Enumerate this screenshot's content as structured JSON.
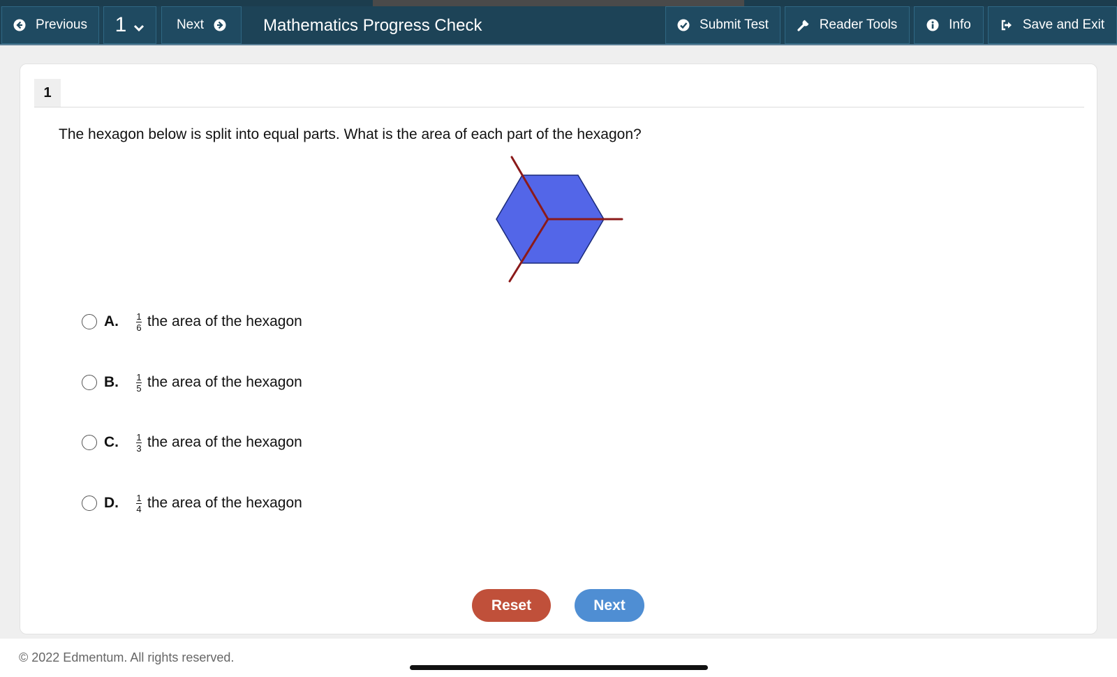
{
  "toolbar": {
    "previous_label": "Previous",
    "question_number": "1",
    "next_label": "Next",
    "title": "Mathematics Progress Check",
    "submit_label": "Submit Test",
    "reader_tools_label": "Reader Tools",
    "info_label": "Info",
    "save_exit_label": "Save and Exit"
  },
  "question": {
    "number": "1",
    "text": "The hexagon below is split into equal parts. What is the area of each part of the hexagon?"
  },
  "choices": [
    {
      "letter": "A.",
      "numerator": "1",
      "denominator": "6",
      "text": "the area of the hexagon"
    },
    {
      "letter": "B.",
      "numerator": "1",
      "denominator": "5",
      "text": "the area of the hexagon"
    },
    {
      "letter": "C.",
      "numerator": "1",
      "denominator": "3",
      "text": "the area of the hexagon"
    },
    {
      "letter": "D.",
      "numerator": "1",
      "denominator": "4",
      "text": "the area of the hexagon"
    }
  ],
  "buttons": {
    "reset_label": "Reset",
    "next_label": "Next"
  },
  "footer": {
    "copyright": "© 2022 Edmentum. All rights reserved."
  },
  "colors": {
    "toolbar": "#1d4357",
    "hexagon_fill": "#5366e8",
    "divider_lines": "#8b1a1a",
    "reset": "#c0503a",
    "next": "#4f8ed3"
  }
}
